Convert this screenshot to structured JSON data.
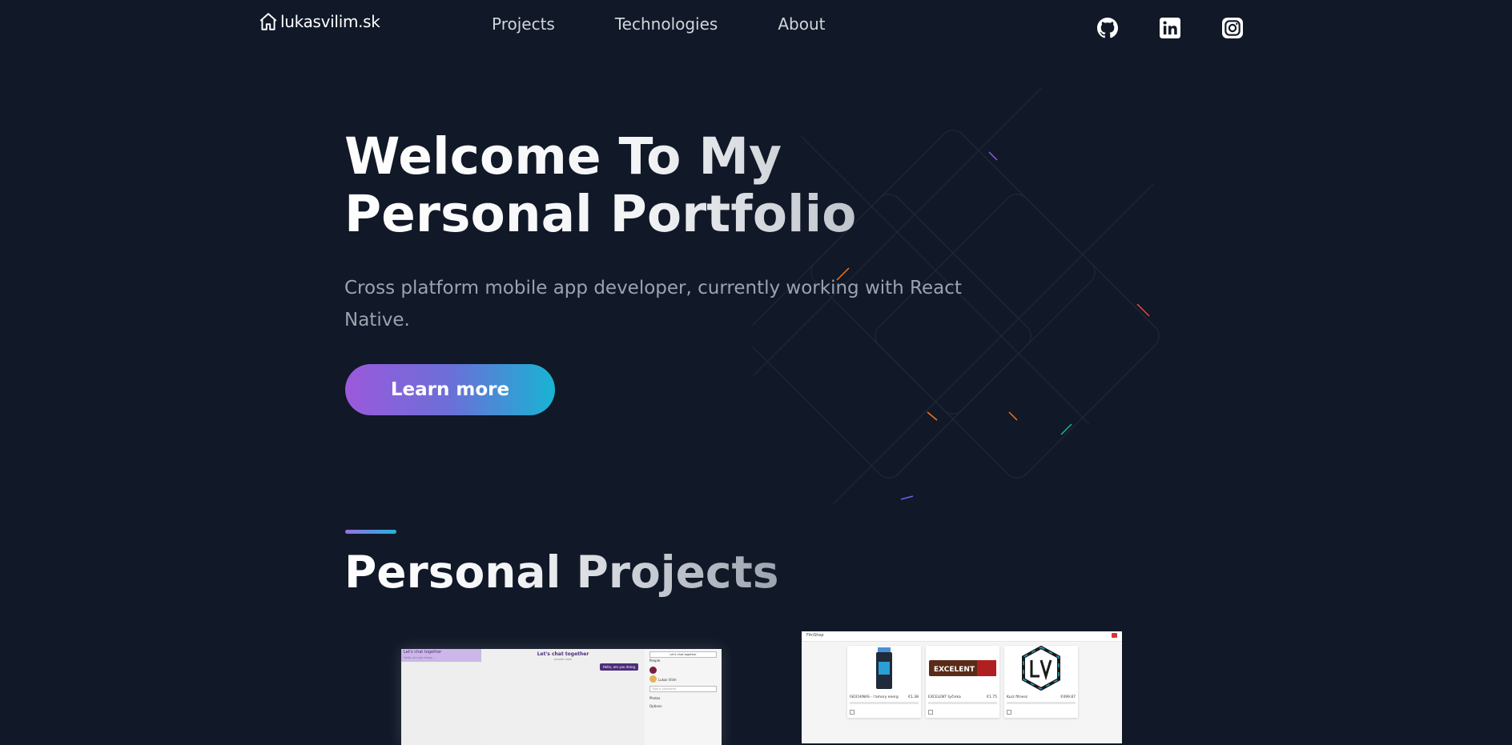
{
  "nav": {
    "brand": "lukasvilim.sk",
    "links": [
      "Projects",
      "Technologies",
      "About"
    ],
    "social_icons": [
      "github-icon",
      "linkedin-icon",
      "instagram-icon"
    ]
  },
  "hero": {
    "title": "Welcome To My Personal Portfolio",
    "subtitle": "Cross platform mobile app developer, currently working with React Native.",
    "cta_label": "Learn more"
  },
  "projects_section": {
    "title": "Personal Projects"
  },
  "projects": {
    "chat": {
      "sidebar_item_title": "Let's chat together",
      "sidebar_item_sub": "Hello, are you doing...",
      "title": "Let's chat together",
      "subtitle": "private room",
      "message": "Hello, are you doing",
      "panel_title": "Let's chat together",
      "panel_people": "People",
      "panel_user": "Lukas Vilim",
      "panel_input": "Type a username",
      "panel_photos": "Photos",
      "panel_options": "Options"
    },
    "shop": {
      "logo": "FitnShop",
      "items": [
        {
          "name": "ISOCHINAS - l'amory energ",
          "price": "€1.38"
        },
        {
          "name": "EXCELENT tyčinka",
          "price": "€1.75"
        },
        {
          "name": "Kurz fitness",
          "price": "€499.87"
        }
      ],
      "bar_text": "EXCELENT"
    }
  },
  "colors": {
    "background": "#111827",
    "cta_gradient_start": "#9b59db",
    "cta_gradient_end": "#18b4d3"
  }
}
